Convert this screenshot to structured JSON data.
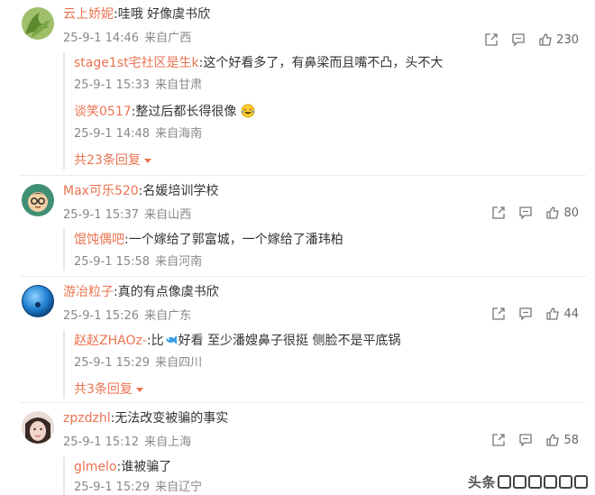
{
  "comments": [
    {
      "username": "云上娇妮",
      "separator": ":",
      "text": "哇哦 好像虞书欣",
      "date": "25-9-1 14:46",
      "location": "来自广西",
      "likes": "230",
      "avatar_icon": "green-plant-avatar",
      "replies": [
        {
          "username": "stage1st宅社区是生k",
          "separator": ":",
          "text": "这个好看多了，有鼻梁而且嘴不凸，头不大",
          "date": "25-9-1 15:33",
          "location": "来自甘肃"
        },
        {
          "username": "谈笑0517",
          "separator": ":",
          "text": "整过后都长得很像",
          "emoji": "laughing-emoji",
          "date": "25-9-1 14:48",
          "location": "来自海南"
        }
      ],
      "more_replies": "共23条回复"
    },
    {
      "username": "Max可乐520",
      "separator": ":",
      "text": "名媛培训学校",
      "date": "25-9-1 15:37",
      "location": "来自山西",
      "likes": "80",
      "avatar_icon": "cartoon-glasses-avatar",
      "replies": [
        {
          "username": "馄饨偶吧",
          "separator": ":",
          "text": "一个嫁给了郭富城，一个嫁给了潘玮柏",
          "date": "25-9-1 15:58",
          "location": "来自河南"
        }
      ]
    },
    {
      "username": "游冶粒子",
      "separator": ":",
      "text": "真的有点像虞书欣",
      "date": "25-9-1 15:26",
      "location": "来自广东",
      "likes": "44",
      "avatar_icon": "blue-sphere-avatar",
      "replies": [
        {
          "username": "赵赵ZHAOz-",
          "separator": ":",
          "text_before": "比",
          "emoji": "fish-emoji",
          "text": "好看 至少潘嫂鼻子很挺 侧脸不是平底锅",
          "date": "25-9-1 15:29",
          "location": "来自四川"
        }
      ],
      "more_replies": "共3条回复"
    },
    {
      "username": "zpzdzhl",
      "separator": ":",
      "text": "无法改变被骗的事实",
      "date": "25-9-1 15:12",
      "location": "来自上海",
      "likes": "58",
      "avatar_icon": "photo-face-avatar",
      "replies": [
        {
          "username": "glmelo",
          "separator": ":",
          "text": "谁被骗了",
          "date": "25-9-1 15:29",
          "location": "来自辽宁"
        }
      ]
    }
  ],
  "watermark": "头条",
  "colors": {
    "username": "#eb7350",
    "meta": "#888888",
    "text": "#333333",
    "divider": "#ececec"
  }
}
